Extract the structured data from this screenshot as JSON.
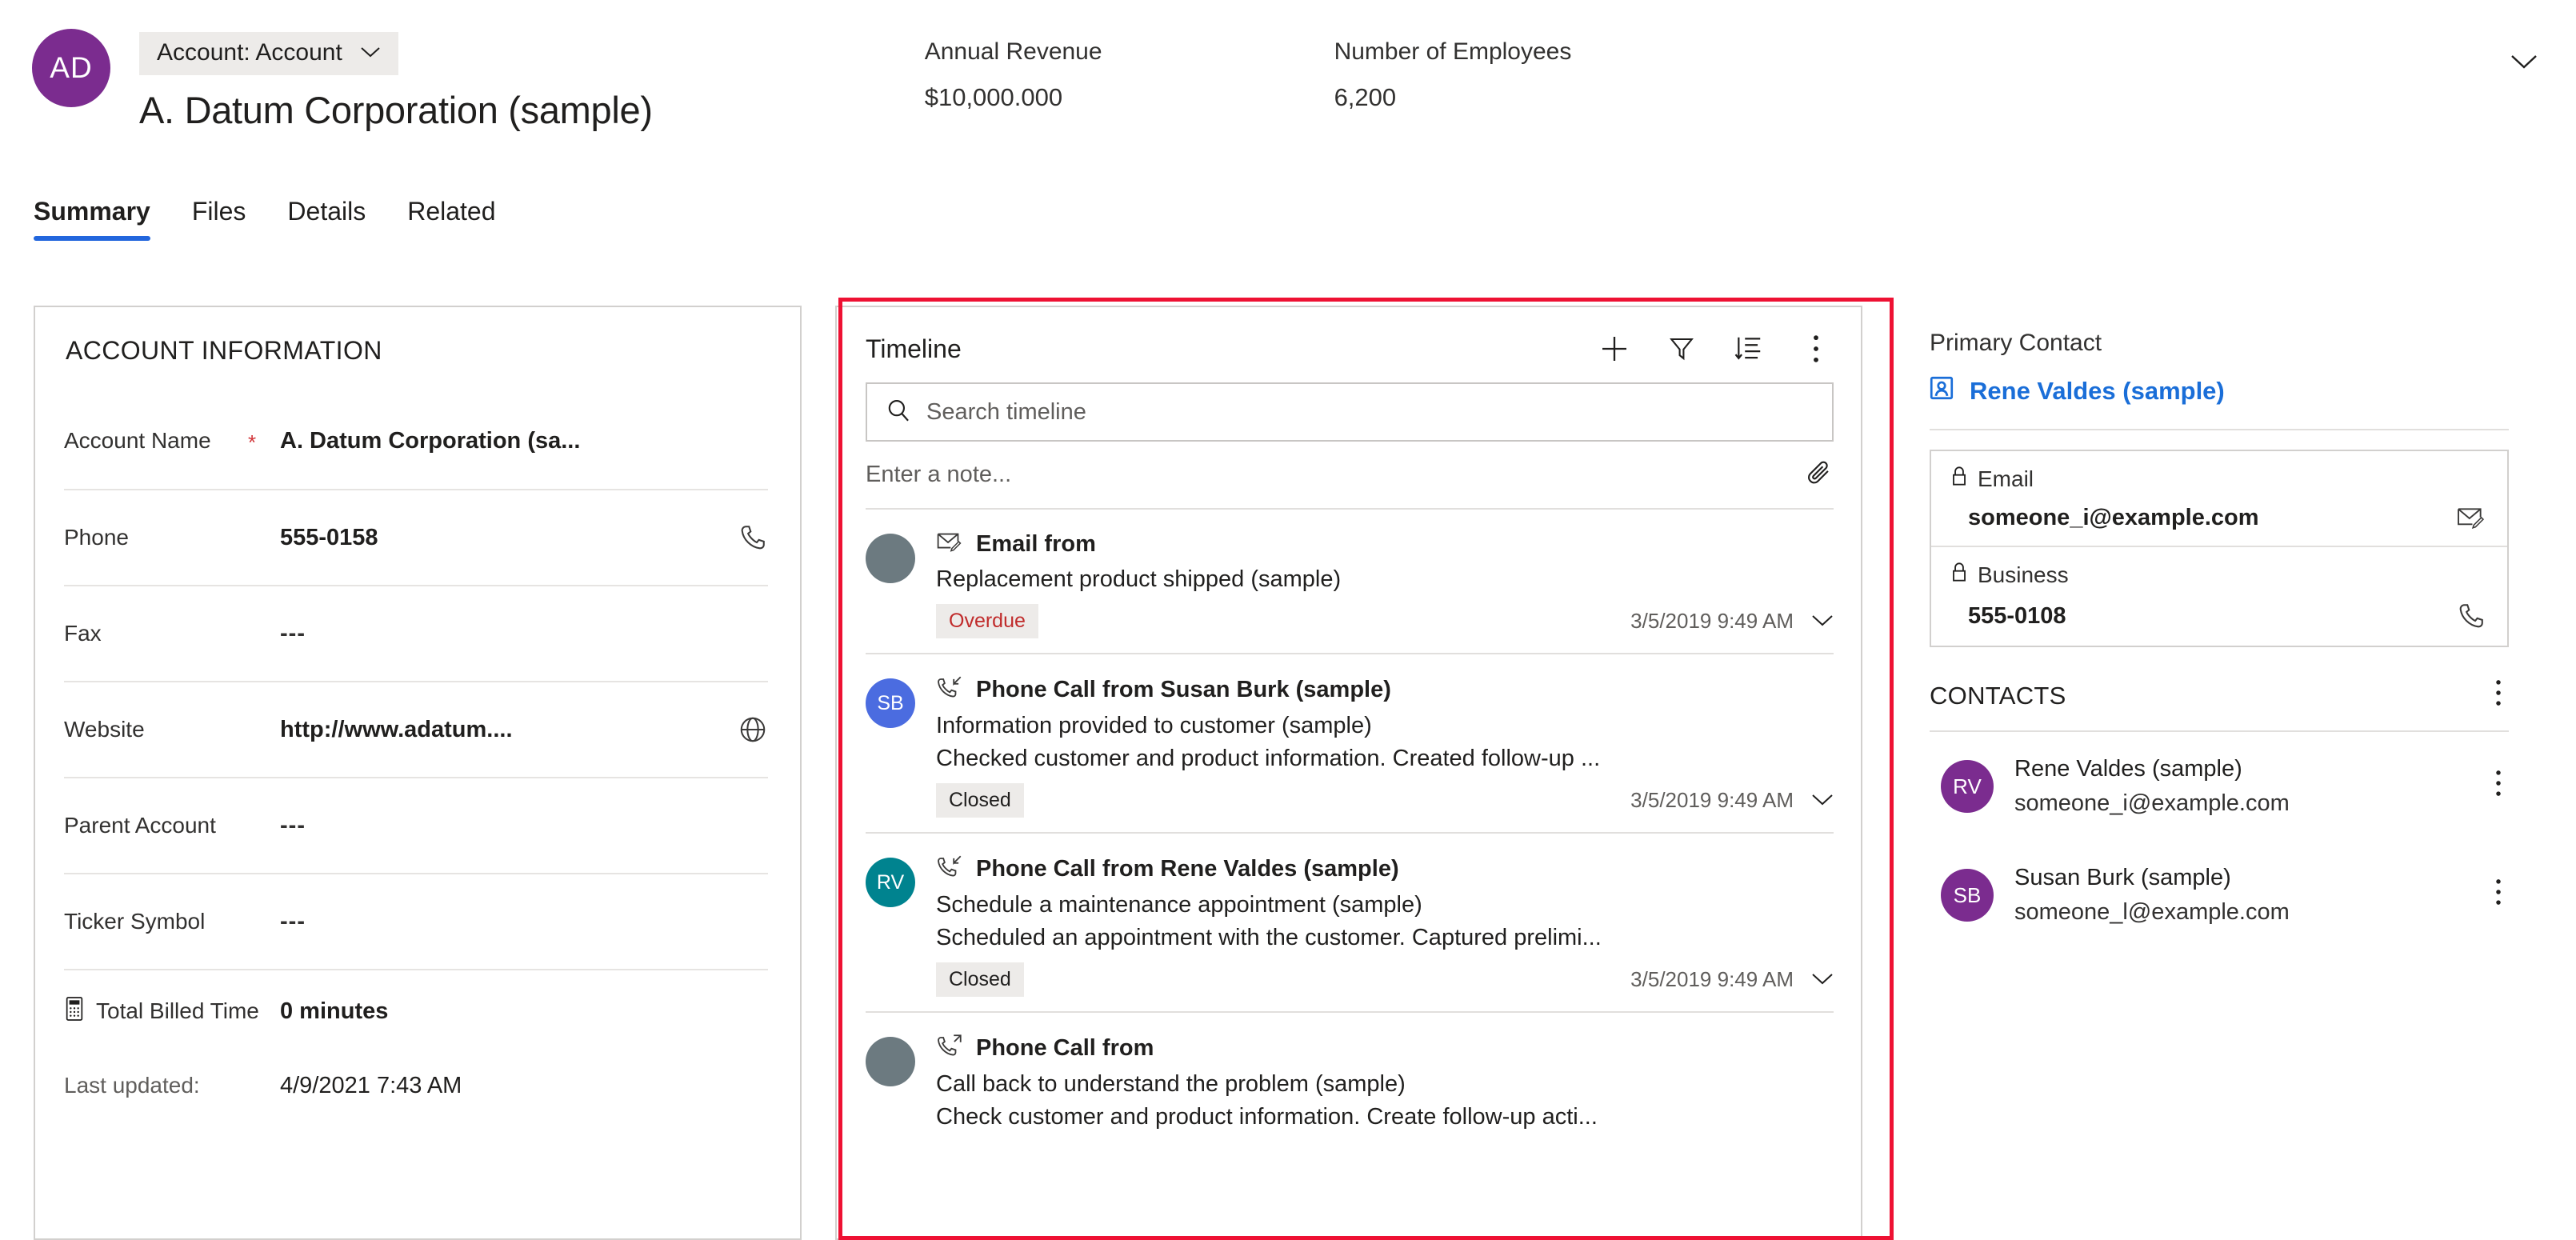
{
  "header": {
    "avatar_initials": "AD",
    "avatar_color": "#7B2C8F",
    "entity_chip": "Account: Account",
    "entity_chip_icon": "chevron-down-icon",
    "record_title": "A. Datum Corporation (sample)",
    "collapse_icon": "chevron-down-icon",
    "stats": [
      {
        "label": "Annual Revenue",
        "value": "$10,000.000"
      },
      {
        "label": "Number of Employees",
        "value": "6,200"
      }
    ]
  },
  "tabs": [
    {
      "label": "Summary",
      "active": true
    },
    {
      "label": "Files",
      "active": false
    },
    {
      "label": "Details",
      "active": false
    },
    {
      "label": "Related",
      "active": false
    }
  ],
  "account_information": {
    "section_title": "ACCOUNT INFORMATION",
    "fields": [
      {
        "label": "Account Name",
        "required": "*",
        "value": "A. Datum Corporation (sa...",
        "icon": ""
      },
      {
        "label": "Phone",
        "required": "",
        "value": "555-0158",
        "icon": "phone-icon"
      },
      {
        "label": "Fax",
        "required": "",
        "value": "---",
        "icon": ""
      },
      {
        "label": "Website",
        "required": "",
        "value": "http://www.adatum....",
        "icon": "globe-icon"
      },
      {
        "label": "Parent Account",
        "required": "",
        "value": "---",
        "icon": ""
      },
      {
        "label": "Ticker Symbol",
        "required": "",
        "value": "---",
        "icon": ""
      }
    ],
    "billed": {
      "label": "Total Billed Time",
      "icon": "calculator-icon",
      "value": "0 minutes"
    },
    "last_updated": {
      "label": "Last updated:",
      "value": "4/9/2021 7:43 AM"
    }
  },
  "timeline": {
    "title": "Timeline",
    "actions": [
      {
        "name": "add-icon",
        "glyph": "+"
      },
      {
        "name": "filter-icon",
        "glyph": "filter"
      },
      {
        "name": "sort-icon",
        "glyph": "sort"
      },
      {
        "name": "more-options-icon",
        "glyph": "ellipsis"
      }
    ],
    "search_placeholder": "Search timeline",
    "search_value": "",
    "note_placeholder": "Enter a note...",
    "note_value": "",
    "attach_icon": "paperclip-icon",
    "items": [
      {
        "avatar_initials": "",
        "avatar_color": "#6C7A80",
        "type_icon": "email-icon",
        "type": "Email from",
        "subject": "Replacement product shipped (sample)",
        "description": "",
        "badge": "Overdue",
        "badge_state": "overdue",
        "time": "3/5/2019 9:49 AM"
      },
      {
        "avatar_initials": "SB",
        "avatar_color": "#4B6CE0",
        "type_icon": "phone-incoming-icon",
        "type": "Phone Call from Susan Burk (sample)",
        "subject": "Information provided to customer (sample)",
        "description": "Checked customer and product information. Created follow-up ...",
        "badge": "Closed",
        "badge_state": "closed",
        "time": "3/5/2019 9:49 AM"
      },
      {
        "avatar_initials": "RV",
        "avatar_color": "#00838F",
        "type_icon": "phone-incoming-icon",
        "type": "Phone Call from Rene Valdes (sample)",
        "subject": "Schedule a maintenance appointment (sample)",
        "description": "Scheduled an appointment with the customer. Captured prelimi...",
        "badge": "Closed",
        "badge_state": "closed",
        "time": "3/5/2019 9:49 AM"
      },
      {
        "avatar_initials": "",
        "avatar_color": "#6C7A80",
        "type_icon": "phone-outgoing-icon",
        "type": "Phone Call from",
        "subject": "Call back to understand the problem (sample)",
        "description": "Check customer and product information. Create follow-up acti...",
        "badge": "",
        "badge_state": "",
        "time": ""
      }
    ]
  },
  "right_panel": {
    "primary_contact_label": "Primary Contact",
    "primary_contact_name": "Rene Valdes (sample)",
    "primary_contact_icon": "contact-card-icon",
    "primary_contact_link_color": "#1a6ed8",
    "fields": [
      {
        "label": "Email",
        "lock_icon": "lock-icon",
        "value": "someone_i@example.com",
        "action_icon": "email-icon"
      },
      {
        "label": "Business",
        "lock_icon": "lock-icon",
        "value": "555-0108",
        "action_icon": "phone-icon"
      }
    ],
    "contacts_title": "CONTACTS",
    "contacts_more_icon": "more-options-icon",
    "contacts": [
      {
        "initials": "RV",
        "avatar_color": "#7B2C8F",
        "name": "Rene Valdes (sample)",
        "email": "someone_i@example.com",
        "more_icon": "more-options-icon"
      },
      {
        "initials": "SB",
        "avatar_color": "#7B2C8F",
        "name": "Susan Burk (sample)",
        "email": "someone_l@example.com",
        "more_icon": "more-options-icon"
      }
    ]
  },
  "annotation": {
    "border_color": "#ee1133"
  }
}
